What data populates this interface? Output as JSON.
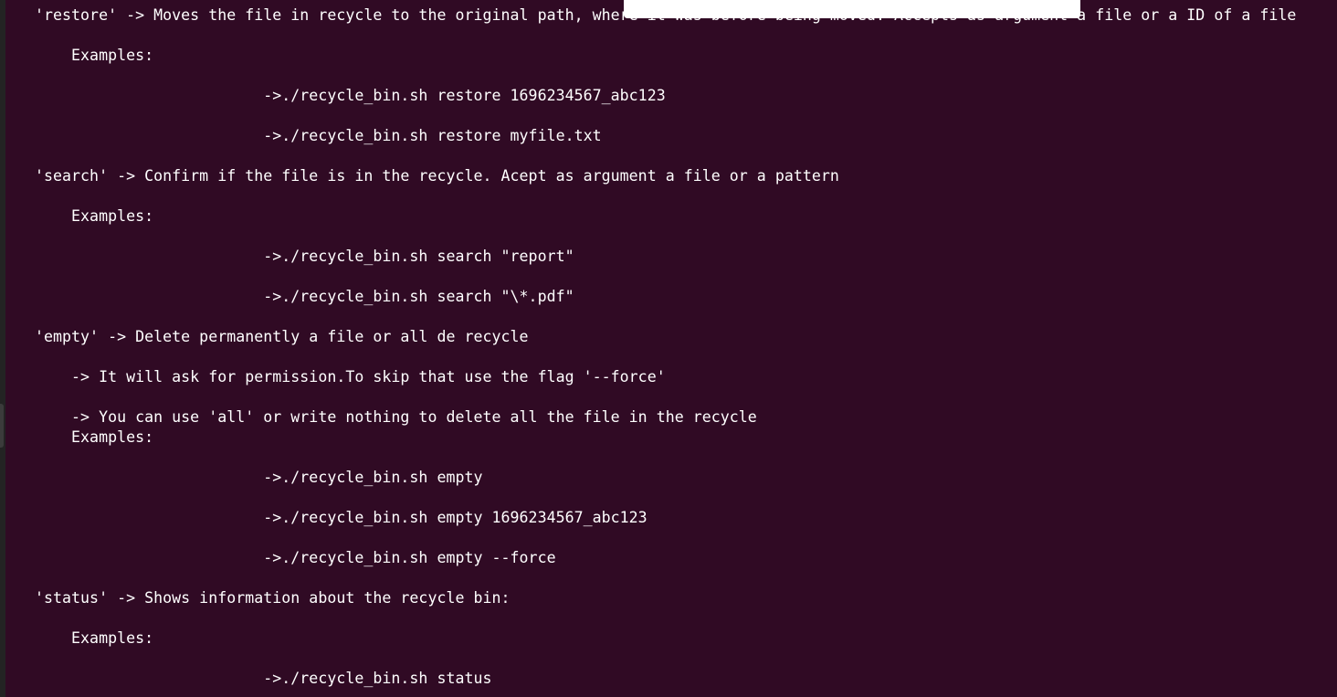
{
  "terminal": {
    "lines": [
      "'restore' -> Moves the file in recycle to the original path, where it was before being moved. Accepts as argument a file or a ID of a file",
      "    Examples:",
      "                         ->./recycle_bin.sh restore 1696234567_abc123",
      "                         ->./recycle_bin.sh restore myfile.txt",
      "'search' -> Confirm if the file is in the recycle. Acept as argument a file or a pattern",
      "    Examples:",
      "                         ->./recycle_bin.sh search \"report\"",
      "                         ->./recycle_bin.sh search \"\\*.pdf\"",
      "'empty' -> Delete permanently a file or all de recycle",
      "    -> It will ask for permission.To skip that use the flag '--force'",
      "    -> You can use 'all' or write nothing to delete all the file in the recycle",
      "    Examples:",
      "                         ->./recycle_bin.sh empty",
      "                         ->./recycle_bin.sh empty 1696234567_abc123",
      "                         ->./recycle_bin.sh empty --force",
      "'status' -> Shows information about the recycle bin:",
      "    Examples:",
      "                         ->./recycle_bin.sh status"
    ]
  },
  "colors": {
    "background": "#300a24",
    "text": "#ffffff",
    "overlay": "#ffffff"
  }
}
